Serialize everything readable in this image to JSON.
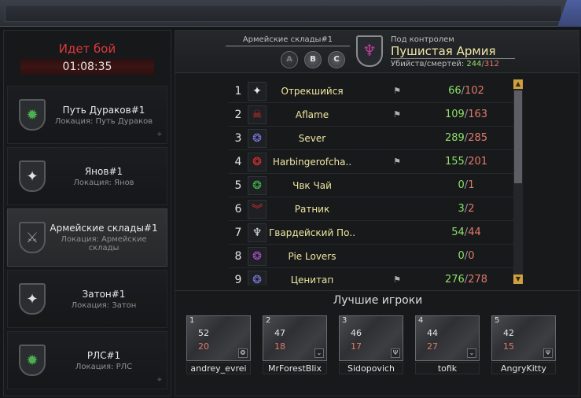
{
  "battle": {
    "status": "Идет бой",
    "timer": "01:08:35"
  },
  "maps": [
    {
      "name": "Путь Дураков#1",
      "location": "Локация: Путь Дураков",
      "icon": "octopus-emblem-icon",
      "glyph": "✹",
      "color": "#4caf50",
      "active": false
    },
    {
      "name": "Янов#1",
      "location": "Локация: Янов",
      "icon": "compass-star-icon",
      "glyph": "✦",
      "color": "#e0e0e0",
      "active": false
    },
    {
      "name": "Армейские склады#1",
      "location": "Локация: Армейские склады",
      "icon": "crossed-blades-icon",
      "glyph": "⚔",
      "color": "#9a9a9a",
      "active": true
    },
    {
      "name": "Затон#1",
      "location": "Локация: Затон",
      "icon": "compass-star-icon",
      "glyph": "✦",
      "color": "#e0e0e0",
      "active": false
    },
    {
      "name": "РЛС#1",
      "location": "Локация: РЛС",
      "icon": "octopus-emblem-icon",
      "glyph": "✹",
      "color": "#4caf50",
      "active": false
    }
  ],
  "header": {
    "location": "Армейские склады#1",
    "buttons": [
      "A",
      "B",
      "C"
    ],
    "control_label": "Под контролем",
    "clan": "Пушистая Армия",
    "kd_label": "Убийств/смертей:",
    "kills": "244",
    "deaths": "312"
  },
  "clans": [
    {
      "rank": "1",
      "name": "Отрекшийся",
      "flag": true,
      "kills": "66",
      "deaths": "102",
      "icon": "compass-star-icon",
      "glyph": "✦",
      "color": "#e8e8e8"
    },
    {
      "rank": "2",
      "name": "Aflame",
      "flag": true,
      "kills": "109",
      "deaths": "163",
      "icon": "skull-icon",
      "glyph": "☠",
      "color": "#e03030"
    },
    {
      "rank": "3",
      "name": "Sever",
      "flag": false,
      "kills": "289",
      "deaths": "285",
      "icon": "wreath-icon",
      "glyph": "❂",
      "color": "#7a7ae0"
    },
    {
      "rank": "4",
      "name": "Harbingerofcha..",
      "flag": true,
      "kills": "155",
      "deaths": "201",
      "icon": "wreath-icon",
      "glyph": "❂",
      "color": "#e03030"
    },
    {
      "rank": "5",
      "name": "Чвк Чай",
      "flag": false,
      "kills": "0",
      "deaths": "1",
      "icon": "wreath-icon",
      "glyph": "❂",
      "color": "#3fbf4a"
    },
    {
      "rank": "6",
      "name": "Ратник",
      "flag": false,
      "kills": "3",
      "deaths": "2",
      "icon": "chevron-rank-icon",
      "glyph": "︾",
      "color": "#e03030"
    },
    {
      "rank": "7",
      "name": "Гвардейский По..",
      "flag": false,
      "kills": "54",
      "deaths": "44",
      "icon": "wings-icon",
      "glyph": "♆",
      "color": "#e0e0e0"
    },
    {
      "rank": "8",
      "name": "Pie Lovers",
      "flag": false,
      "kills": "0",
      "deaths": "0",
      "icon": "wreath-icon",
      "glyph": "❂",
      "color": "#b050d0"
    },
    {
      "rank": "9",
      "name": "Ценитап",
      "flag": true,
      "kills": "276",
      "deaths": "278",
      "icon": "wreath-icon",
      "glyph": "❂",
      "color": "#7a7ae0"
    }
  ],
  "best_title": "Лучшие игроки",
  "players": [
    {
      "rank": "1",
      "kills": "52",
      "deaths": "20",
      "name": "andrey_evrei",
      "badge": "wreath-badge-icon",
      "glyph": "❂"
    },
    {
      "rank": "2",
      "kills": "47",
      "deaths": "18",
      "name": "MrForestBlix",
      "badge": "chevron-badge-icon",
      "glyph": "⌄"
    },
    {
      "rank": "3",
      "kills": "46",
      "deaths": "17",
      "name": "Sidopovich",
      "badge": "trident-badge-icon",
      "glyph": "Ψ"
    },
    {
      "rank": "4",
      "kills": "44",
      "deaths": "27",
      "name": "tofik",
      "badge": "chevron-badge-icon",
      "glyph": "⌄"
    },
    {
      "rank": "5",
      "kills": "42",
      "deaths": "15",
      "name": "AngryKitty",
      "badge": "trident-badge-icon",
      "glyph": "Ψ"
    }
  ]
}
